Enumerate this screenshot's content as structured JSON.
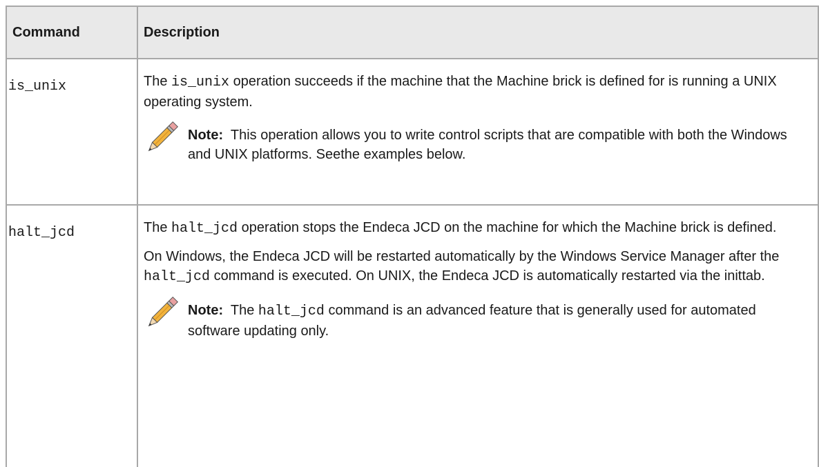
{
  "table": {
    "headers": {
      "command": "Command",
      "description": "Description"
    },
    "rows": [
      {
        "command": "is_unix",
        "desc_p1_pre": "The ",
        "desc_p1_code": "is_unix",
        "desc_p1_post": " operation succeeds if the machine that the Machine brick is defined for is running a UNIX operating system.",
        "note_label": "Note:",
        "note_text": "  This operation allows you to write control scripts that are compatible with both the Windows and UNIX platforms. Seethe examples below."
      },
      {
        "command": "halt_jcd",
        "desc_p1_pre": "The ",
        "desc_p1_code": "halt_jcd",
        "desc_p1_post": " operation stops the Endeca JCD on the machine for which the Machine brick is defined.",
        "desc_p2_pre": "On Windows, the Endeca JCD will be restarted automatically by the Windows Service Manager after the ",
        "desc_p2_code": "halt_jcd",
        "desc_p2_post": " command is executed. On UNIX, the Endeca JCD is automatically restarted via the inittab.",
        "note_label": "Note:",
        "note_pre": "  The ",
        "note_code": "halt_jcd",
        "note_post": " command is an advanced feature that is generally used for automated software updating only."
      }
    ]
  },
  "icons": {
    "note": "pencil-icon"
  }
}
